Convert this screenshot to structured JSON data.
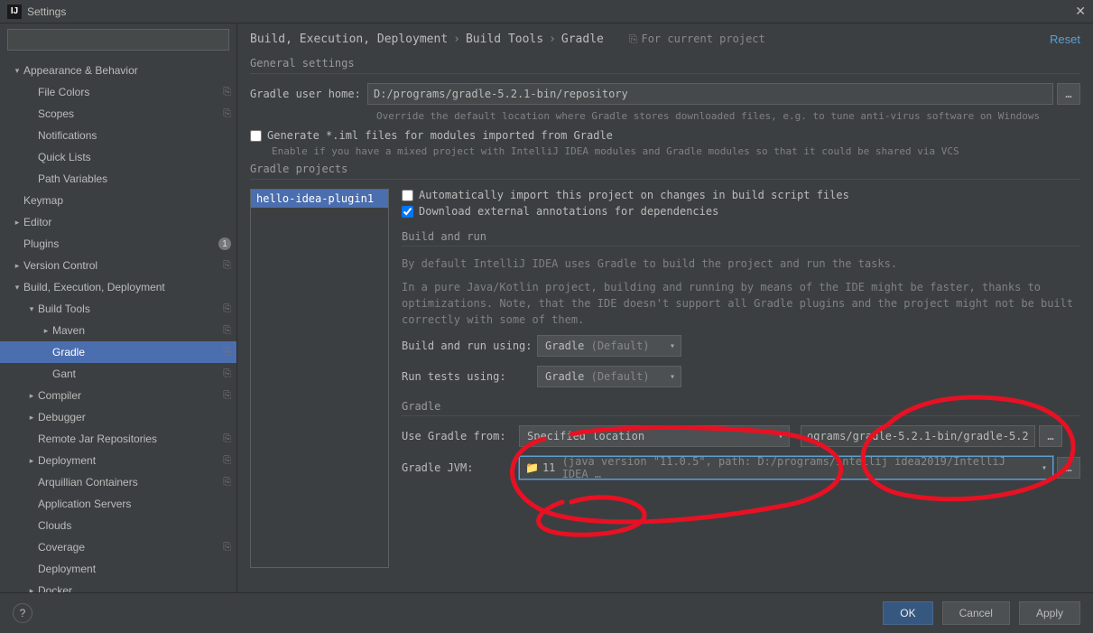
{
  "title": "Settings",
  "search_placeholder": "",
  "sidebar": {
    "items": [
      {
        "label": "Appearance & Behavior",
        "depth": 0,
        "expand": "▾",
        "link": false
      },
      {
        "label": "File Colors",
        "depth": 1,
        "expand": "",
        "link": true
      },
      {
        "label": "Scopes",
        "depth": 1,
        "expand": "",
        "link": true
      },
      {
        "label": "Notifications",
        "depth": 1,
        "expand": "",
        "link": false
      },
      {
        "label": "Quick Lists",
        "depth": 1,
        "expand": "",
        "link": false
      },
      {
        "label": "Path Variables",
        "depth": 1,
        "expand": "",
        "link": false
      },
      {
        "label": "Keymap",
        "depth": 0,
        "expand": "",
        "link": false
      },
      {
        "label": "Editor",
        "depth": 0,
        "expand": "▸",
        "link": false
      },
      {
        "label": "Plugins",
        "depth": 0,
        "expand": "",
        "badge": "1",
        "link": false
      },
      {
        "label": "Version Control",
        "depth": 0,
        "expand": "▸",
        "link": true
      },
      {
        "label": "Build, Execution, Deployment",
        "depth": 0,
        "expand": "▾",
        "link": false
      },
      {
        "label": "Build Tools",
        "depth": 1,
        "expand": "▾",
        "link": true
      },
      {
        "label": "Maven",
        "depth": 2,
        "expand": "▸",
        "link": true
      },
      {
        "label": "Gradle",
        "depth": 2,
        "expand": "",
        "link": true,
        "selected": true
      },
      {
        "label": "Gant",
        "depth": 2,
        "expand": "",
        "link": true
      },
      {
        "label": "Compiler",
        "depth": 1,
        "expand": "▸",
        "link": true
      },
      {
        "label": "Debugger",
        "depth": 1,
        "expand": "▸",
        "link": false
      },
      {
        "label": "Remote Jar Repositories",
        "depth": 1,
        "expand": "",
        "link": true
      },
      {
        "label": "Deployment",
        "depth": 1,
        "expand": "▸",
        "link": true
      },
      {
        "label": "Arquillian Containers",
        "depth": 1,
        "expand": "",
        "link": true
      },
      {
        "label": "Application Servers",
        "depth": 1,
        "expand": "",
        "link": false
      },
      {
        "label": "Clouds",
        "depth": 1,
        "expand": "",
        "link": false
      },
      {
        "label": "Coverage",
        "depth": 1,
        "expand": "",
        "link": true
      },
      {
        "label": "Deployment",
        "depth": 1,
        "expand": "",
        "link": false
      },
      {
        "label": "Docker",
        "depth": 1,
        "expand": "▸",
        "link": false
      }
    ]
  },
  "breadcrumb": {
    "parts": [
      "Build, Execution, Deployment",
      "Build Tools",
      "Gradle"
    ],
    "for_current": "For current project",
    "reset": "Reset"
  },
  "general": {
    "title": "General settings",
    "user_home_label": "Gradle user home:",
    "user_home_value": "D:/programs/gradle-5.2.1-bin/repository",
    "user_home_hint": "Override the default location where Gradle stores downloaded files, e.g. to tune anti-virus software on Windows",
    "gen_iml_label": "Generate *.iml files for modules imported from Gradle",
    "gen_iml_hint": "Enable if you have a mixed project with IntelliJ IDEA modules and Gradle modules so that it could be shared via VCS"
  },
  "projects": {
    "title": "Gradle projects",
    "list": [
      "hello-idea-plugin1"
    ],
    "auto_import_label": "Automatically import this project on changes in build script files",
    "download_annotations_label": "Download external annotations for dependencies",
    "build_run": {
      "title": "Build and run",
      "desc1": "By default IntelliJ IDEA uses Gradle to build the project and run the tasks.",
      "desc2": "In a pure Java/Kotlin project, building and running by means of the IDE might be faster, thanks to optimizations. Note, that the IDE doesn't support all Gradle plugins and the project might not be built correctly with some of them.",
      "build_label": "Build and run using:",
      "build_value": "Gradle",
      "build_default": "(Default)",
      "tests_label": "Run tests using:",
      "tests_value": "Gradle",
      "tests_default": "(Default)"
    },
    "gradle": {
      "title": "Gradle",
      "use_from_label": "Use Gradle from:",
      "use_from_value": "Specified location",
      "location_value": "ograms/gradle-5.2.1-bin/gradle-5.2.1",
      "jvm_label": "Gradle JVM:",
      "jvm_value": "11",
      "jvm_detail": "(java version \"11.0.5\", path: D:/programs/intellij idea2019/IntelliJ IDEA …"
    }
  },
  "footer": {
    "ok": "OK",
    "cancel": "Cancel",
    "apply": "Apply"
  }
}
